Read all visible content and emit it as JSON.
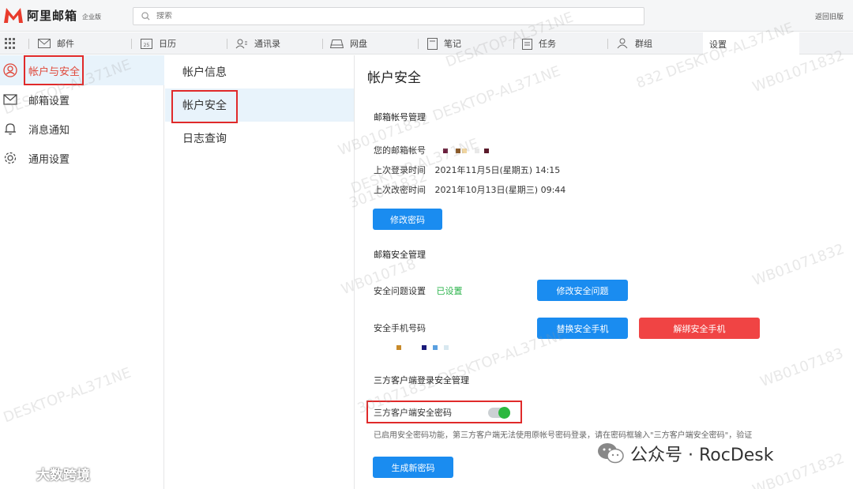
{
  "header": {
    "brand": "阿里邮箱",
    "edition": "企业版",
    "search_placeholder": "搜索",
    "back_old": "返回旧版"
  },
  "nav": {
    "items": [
      {
        "label": "邮件",
        "icon": "mail-icon"
      },
      {
        "label": "日历",
        "icon": "calendar-icon",
        "badge": "25"
      },
      {
        "label": "通讯录",
        "icon": "contacts-icon"
      },
      {
        "label": "网盘",
        "icon": "drive-icon"
      },
      {
        "label": "笔记",
        "icon": "note-icon"
      },
      {
        "label": "任务",
        "icon": "task-icon"
      },
      {
        "label": "群组",
        "icon": "group-icon"
      },
      {
        "label": "设置",
        "icon": ""
      }
    ]
  },
  "sidebar": {
    "items": [
      {
        "label": "帐户与安全",
        "icon": "user-icon"
      },
      {
        "label": "邮箱设置",
        "icon": "envelope-icon"
      },
      {
        "label": "消息通知",
        "icon": "bell-icon"
      },
      {
        "label": "通用设置",
        "icon": "gear-icon"
      }
    ]
  },
  "subnav": {
    "items": [
      "帐户信息",
      "帐户安全",
      "日志查询"
    ]
  },
  "content": {
    "title": "帐户安全",
    "mailbox_mgmt": {
      "heading": "邮箱帐号管理",
      "account_label": "您的邮箱帐号",
      "last_login_label": "上次登录时间",
      "last_login_value": "2021年11月5日(星期五) 14:15",
      "last_pwd_label": "上次改密时间",
      "last_pwd_value": "2021年10月13日(星期三) 09:44",
      "change_pwd_button": "修改密码"
    },
    "security_mgmt": {
      "heading": "邮箱安全管理",
      "question_label": "安全问题设置",
      "question_status": "已设置",
      "question_button": "修改安全问题",
      "phone_label": "安全手机号码",
      "replace_phone_button": "替换安全手机",
      "unbind_phone_button": "解绑安全手机"
    },
    "thirdparty": {
      "heading": "三方客户端登录安全管理",
      "password_label": "三方客户端安全密码",
      "toggle_on": true,
      "note": "已启用安全密码功能，第三方客户端无法使用原帐号密码登录，请在密码框输入\"三方客户端安全密码\"，验证",
      "generate_button": "生成新密码"
    }
  },
  "watermarks": [
    "DESKTOP-AL371NE",
    "WB01071832",
    "DESKTOP-AL371NE",
    "WB01071832 DESKTOP-AL371NE",
    "DESKTOP-AL371NE",
    "WB01071832",
    "WB010718",
    "301071832",
    "301071832 DESKTOP-AL371NE",
    "WB01071832",
    "832 DESKTOP-AL371NE",
    "DESKTOP-AL371NE",
    "WB0107183"
  ],
  "footer": {
    "wechat_brand": "公众号 · RocDesk",
    "corner_brand": "大数跨境"
  },
  "colors": {
    "accent_blue": "#1a8cf0",
    "danger_red": "#f04444",
    "success_green": "#2cb83f",
    "highlight_red": "#e02a2a"
  }
}
